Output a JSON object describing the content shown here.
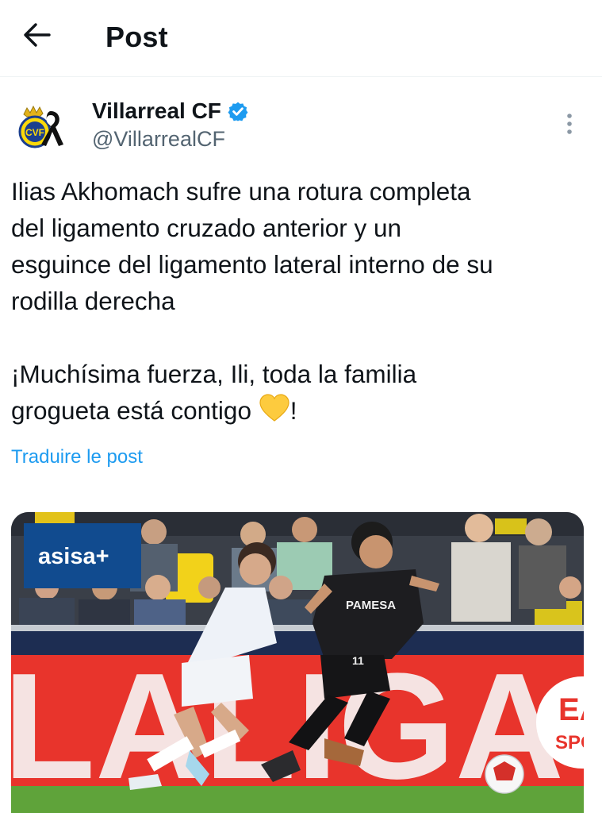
{
  "header": {
    "title": "Post",
    "back_icon": "arrow-left-icon"
  },
  "author": {
    "name": "Villarreal CF",
    "handle": "@VillarrealCF",
    "verified": true,
    "verified_color": "#1d9bf0",
    "avatar_icon": "villarreal-crest-icon",
    "more_icon": "more-vertical-icon"
  },
  "tweet": {
    "paragraph1": "Ilias Akhomach sufre una rotura completa\ndel ligamento cruzado anterior y un\nesguince del ligamento lateral interno de su\nrodilla derecha",
    "paragraph2_line1": "¡Muchísima fuerza, Ili, toda la familia",
    "paragraph2_line2_text": "grogueta está contigo ",
    "paragraph2_line2_end": "!",
    "emoji_icon": "yellow-heart-icon",
    "translate_label": "Traduire le post",
    "link_color": "#1d9bf0"
  },
  "media": {
    "sponsor_logo": "asisa+",
    "shirt_sponsor": "PAMESA",
    "player_number": "11",
    "board_text": "LALIGA",
    "ea_text": "EA",
    "sports_text": "SPO"
  }
}
